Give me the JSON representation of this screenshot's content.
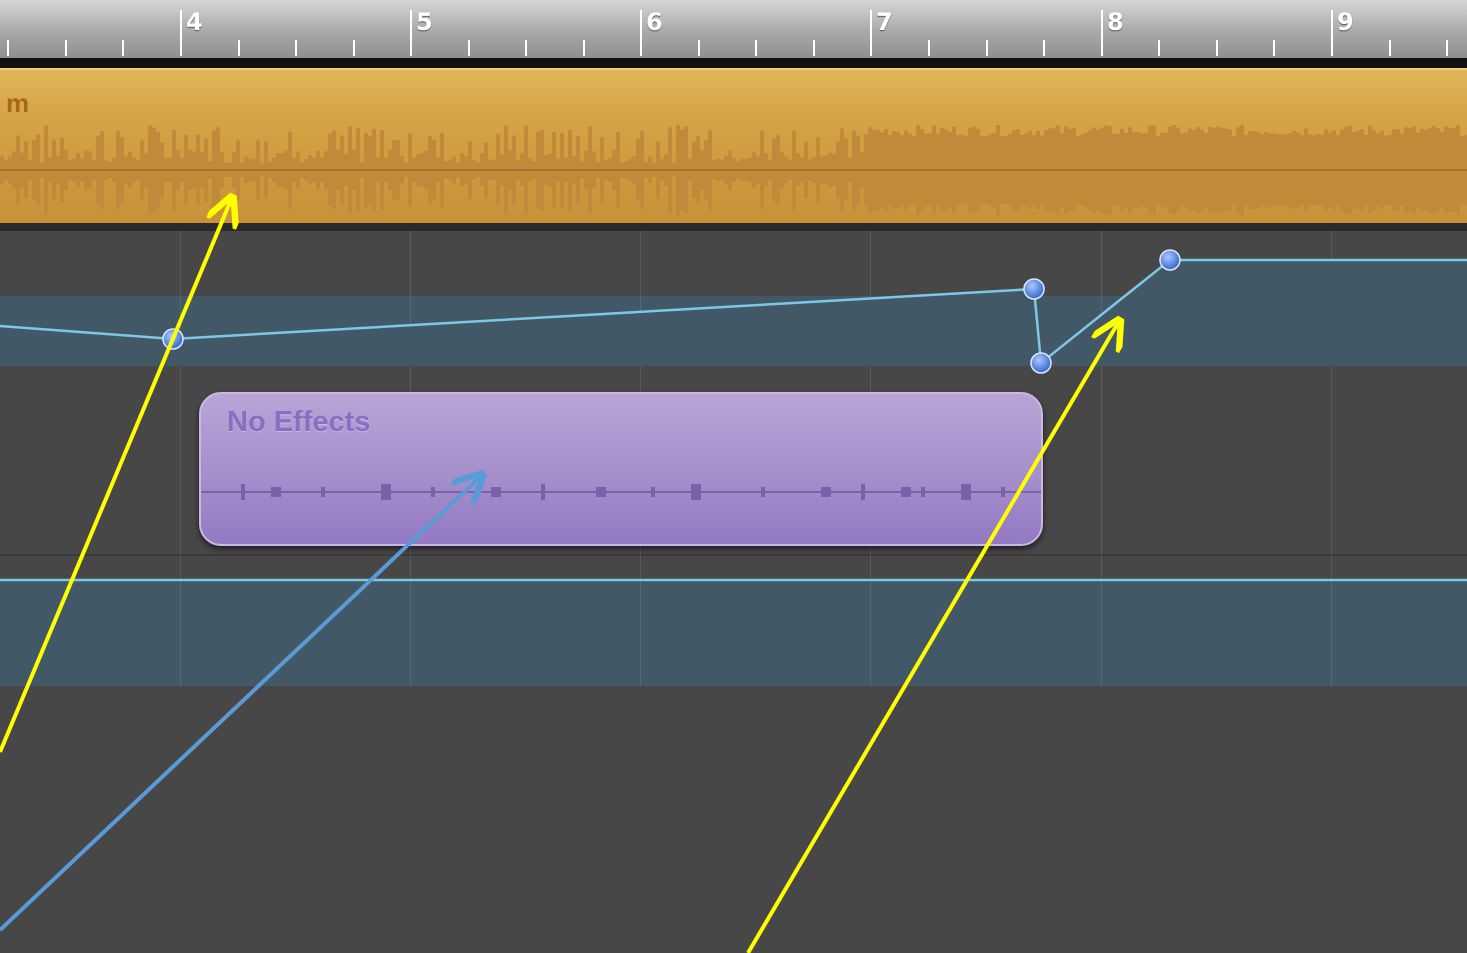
{
  "ruler": {
    "bars": [
      "4",
      "5",
      "6",
      "7",
      "8",
      "9"
    ]
  },
  "tracks": {
    "audio_region": {
      "name": "m",
      "color": "#d4a445"
    },
    "effects_region": {
      "name": "No Effects",
      "color": "#a791cc"
    },
    "automation_color": "#7ec7e6",
    "lane_color": "#425866"
  },
  "annotations": {
    "yellow_arrow_color": "#ffff00",
    "blue_arrow_color": "#5a9bd5"
  }
}
